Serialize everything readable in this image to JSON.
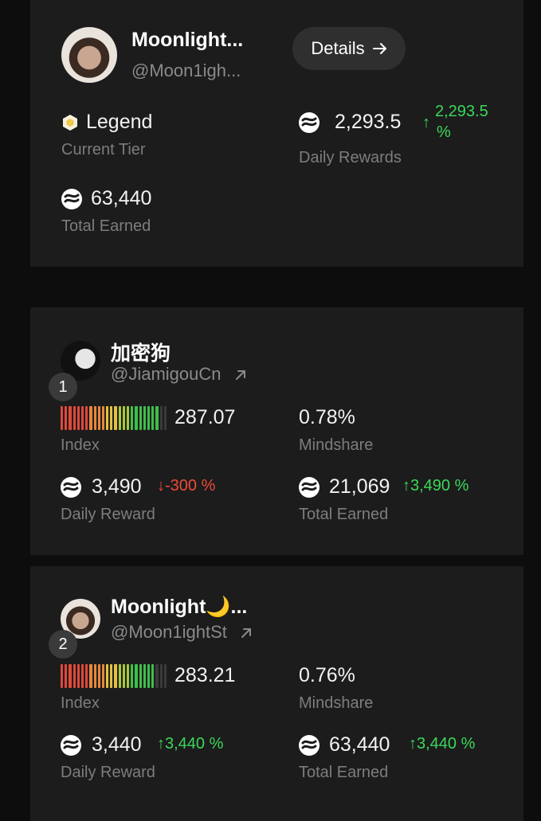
{
  "profile": {
    "name": "Moonlight...",
    "handle": "@Moon1igh...",
    "details_label": "Details",
    "tier_value": "Legend",
    "tier_label": "Current Tier",
    "daily_rewards_value": "2,293.5",
    "daily_rewards_change_line1": "2,293.5",
    "daily_rewards_change_line2": "%",
    "daily_rewards_label": "Daily Rewards",
    "total_earned_value": "63,440",
    "total_earned_label": "Total Earned"
  },
  "leaderboard": [
    {
      "rank": "1",
      "name": "加密狗",
      "handle": "@JiamigouCn",
      "index_value": "287.07",
      "index_label": "Index",
      "index_level": 0.92,
      "mindshare_value": "0.78%",
      "mindshare_label": "Mindshare",
      "daily_reward_value": "3,490",
      "daily_reward_change": "-300 %",
      "daily_reward_direction": "down",
      "daily_reward_label": "Daily Reward",
      "total_earned_value": "21,069",
      "total_earned_change": "3,490 %",
      "total_earned_direction": "up",
      "total_earned_label": "Total Earned"
    },
    {
      "rank": "2",
      "name": "Moonlight🌙...",
      "handle": "@Moon1ightSt",
      "index_value": "283.21",
      "index_label": "Index",
      "index_level": 0.9,
      "mindshare_value": "0.76%",
      "mindshare_label": "Mindshare",
      "daily_reward_value": "3,440",
      "daily_reward_change": "3,440 %",
      "daily_reward_direction": "up",
      "daily_reward_label": "Daily Reward",
      "total_earned_value": "63,440",
      "total_earned_change": "3,440 %",
      "total_earned_direction": "up",
      "total_earned_label": "Total Earned"
    }
  ],
  "colors": {
    "up": "#3ad85a",
    "down": "#ef4a3a",
    "card_bg": "#1c1c1c",
    "legend_badge": "#f2c94c"
  },
  "icons": {
    "token": "token-wave-icon",
    "tier": "hexagon-badge-icon",
    "arrow": "arrow-right-icon",
    "external": "external-link-icon"
  }
}
